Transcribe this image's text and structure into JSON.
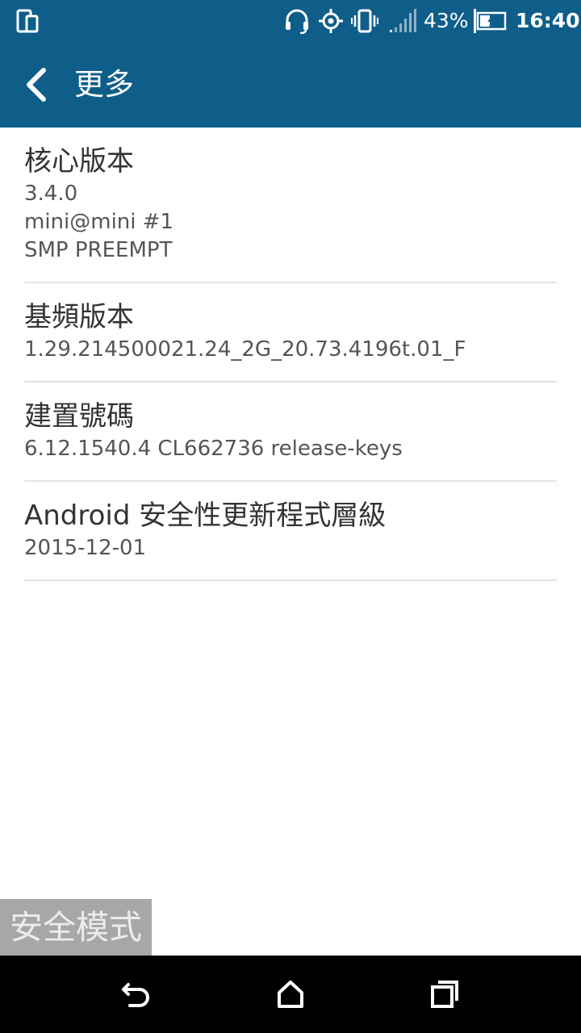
{
  "status_bar": {
    "icons": [
      "screen-mirror-icon",
      "headset-icon",
      "gps-icon",
      "vibrate-icon",
      "signal-icon",
      "battery-charging-icon"
    ],
    "battery_percent": "43%",
    "battery_level": 0.43,
    "time": "16:40"
  },
  "action_bar": {
    "back_icon": "chevron-left-icon",
    "title": "更多"
  },
  "items": [
    {
      "title": "核心版本",
      "value_lines": [
        "3.4.0",
        "mini@mini #1",
        "SMP PREEMPT"
      ]
    },
    {
      "title": "基頻版本",
      "value_lines": [
        "1.29.214500021.24_2G_20.73.4196t.01_F"
      ]
    },
    {
      "title": "建置號碼",
      "value_lines": [
        "6.12.1540.4 CL662736 release-keys"
      ]
    },
    {
      "title": "Android 安全性更新程式層級",
      "value_lines": [
        "2015-12-01"
      ]
    }
  ],
  "safe_mode_label": "安全模式",
  "nav_bar": {
    "icons": [
      "back-arrow-icon",
      "home-icon",
      "recent-apps-icon"
    ]
  },
  "colors": {
    "primary": "#0f5e8a",
    "title_text": "#333333",
    "value_text": "#555555",
    "divider": "#e3e3e3",
    "safe_mode_bg": "#a7a7a7",
    "nav_bg": "#000000"
  }
}
